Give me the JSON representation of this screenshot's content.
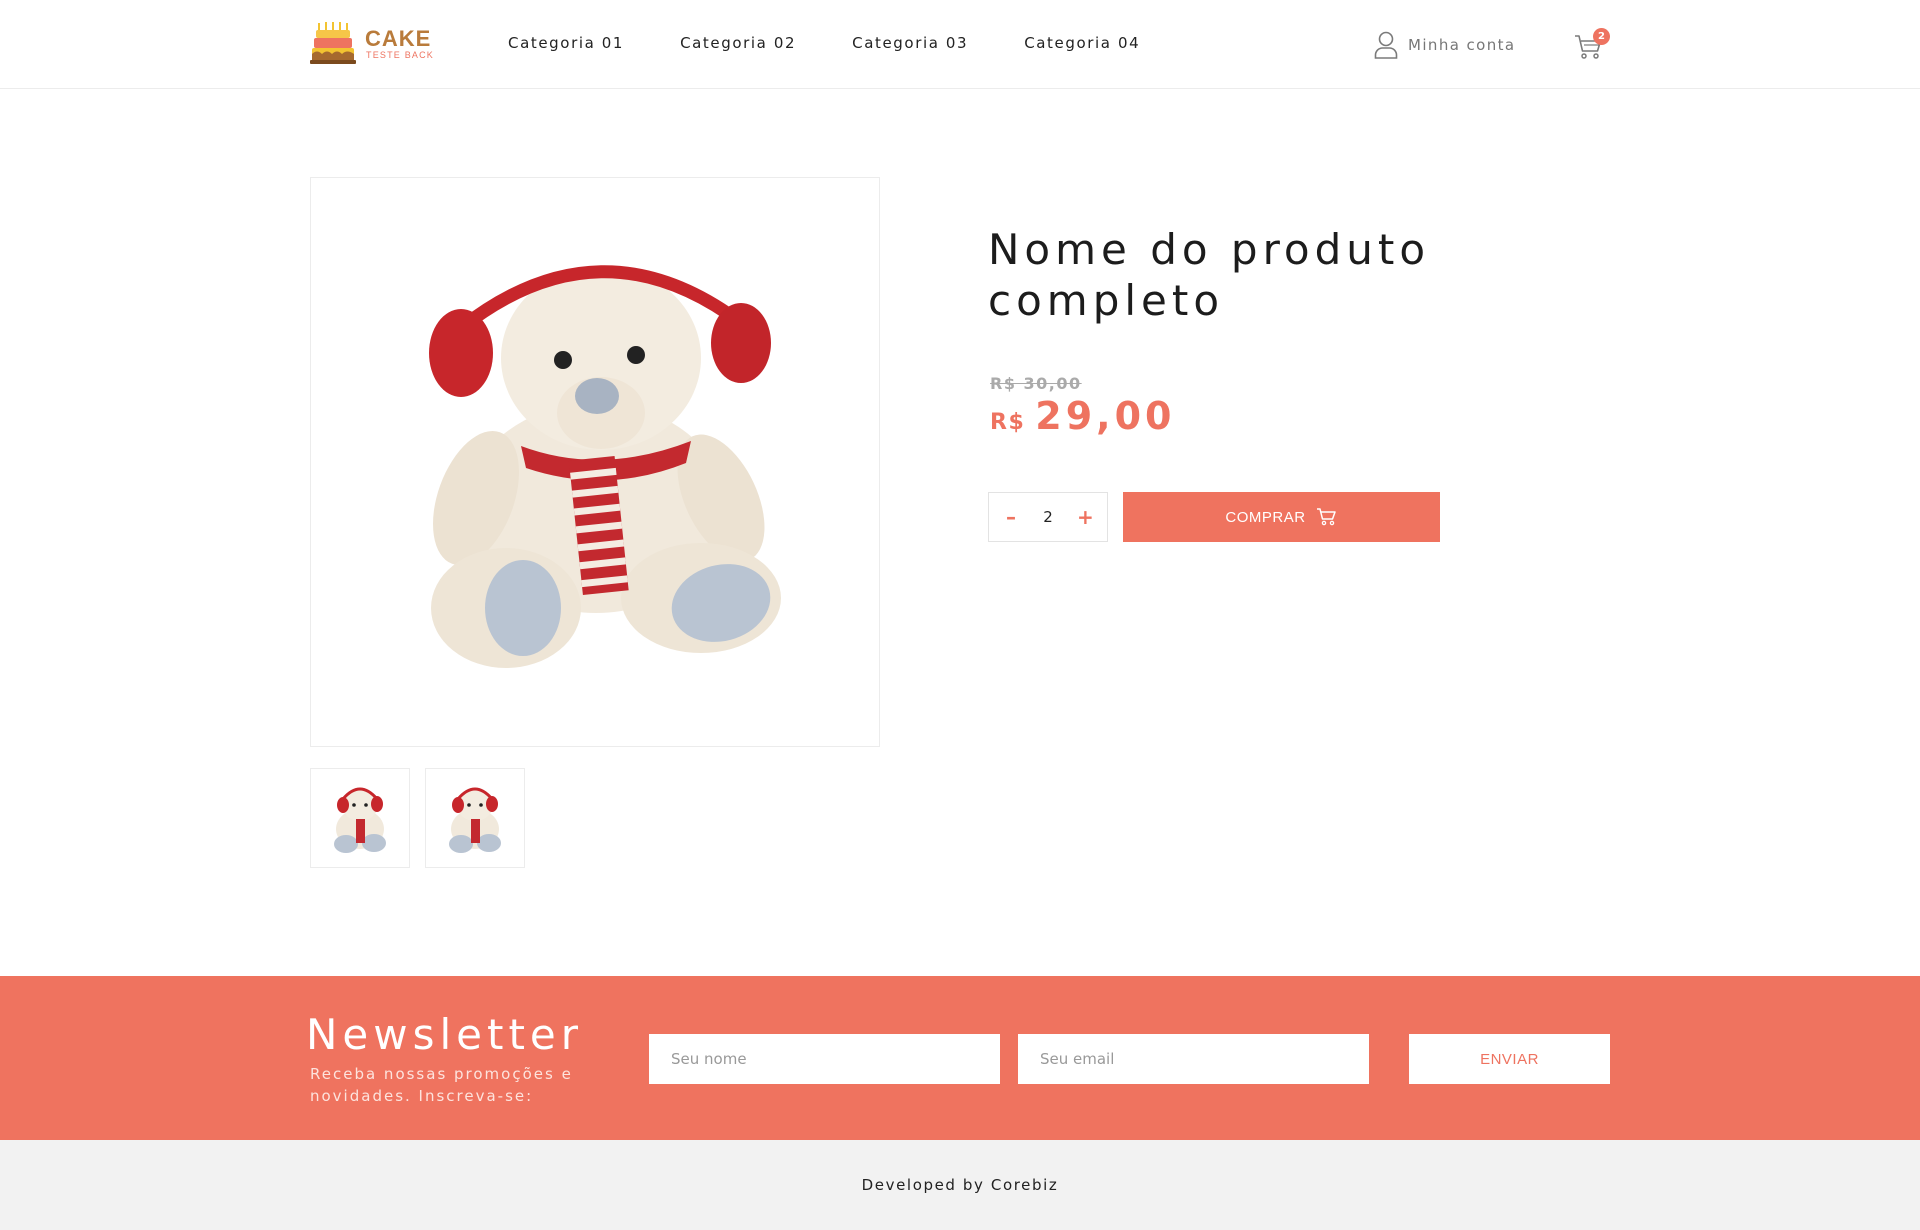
{
  "header": {
    "logo": {
      "title": "CAKE",
      "subtitle": "TESTE BACK"
    },
    "nav": [
      "Categoria 01",
      "Categoria 02",
      "Categoria 03",
      "Categoria 04"
    ],
    "account_label": "Minha conta",
    "cart_count": "2"
  },
  "product": {
    "name": "Nome do produto completo",
    "price_old": "R$ 30,00",
    "price_currency": "R$",
    "price_value": "29,00",
    "quantity": "2",
    "qty_minus": "–",
    "qty_plus": "+",
    "buy_label": "COMPRAR",
    "thumbnail_count": 2
  },
  "newsletter": {
    "title": "Newsletter",
    "subtitle": "Receba nossas promoções e novidades. Inscreva-se:",
    "name_placeholder": "Seu nome",
    "email_placeholder": "Seu email",
    "send_label": "ENVIAR"
  },
  "footer": {
    "text": "Developed by Corebiz"
  },
  "colors": {
    "accent": "#ef735f",
    "logo_brown": "#b97b3b",
    "footer_bg": "#f2f2f2"
  },
  "icons": [
    "cake-logo-icon",
    "user-icon",
    "cart-icon",
    "teddy-bear-image"
  ]
}
